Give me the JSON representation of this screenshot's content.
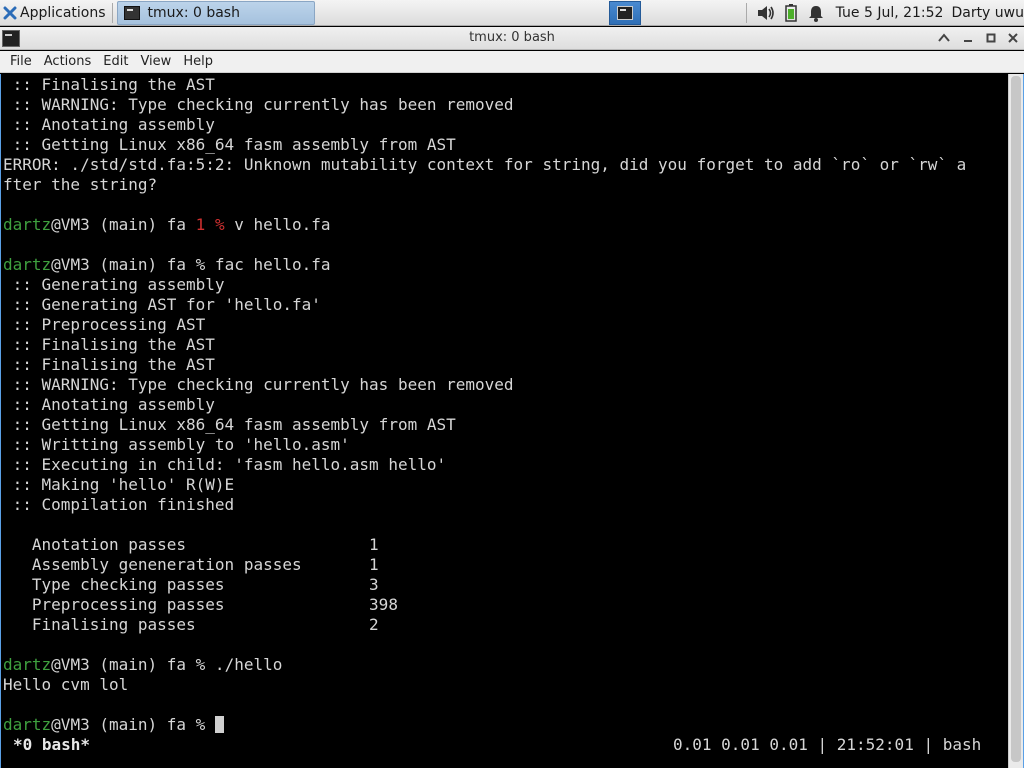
{
  "panel": {
    "apps_label": "Applications",
    "task_label": "tmux: 0 bash",
    "clock": "Tue  5 Jul, 21:52",
    "user": "Darty uwu",
    "icons": [
      "xfce-logo-icon",
      "terminal-icon",
      "volume-icon",
      "battery-icon",
      "notification-bell-icon"
    ]
  },
  "window": {
    "title": "tmux: 0 bash",
    "menu": [
      "File",
      "Actions",
      "Edit",
      "View",
      "Help"
    ]
  },
  "terminal": {
    "lines": [
      [
        {
          "t": " :: Finalising the AST"
        }
      ],
      [
        {
          "t": " :: WARNING: Type checking currently has been removed"
        }
      ],
      [
        {
          "t": " :: Anotating assembly"
        }
      ],
      [
        {
          "t": " :: Getting Linux x86_64 fasm assembly from AST"
        }
      ],
      [
        {
          "t": "ERROR: ./std/std.fa:5:2: Unknown mutability context for string, did you forget to add `ro` or `rw` a"
        }
      ],
      [
        {
          "t": "fter the string?"
        }
      ],
      [
        {
          "t": ""
        }
      ],
      [
        {
          "t": "dartz",
          "c": "user"
        },
        {
          "t": "@VM3 (main) fa "
        },
        {
          "t": "1 %",
          "c": "err"
        },
        {
          "t": " v hello.fa"
        }
      ],
      [
        {
          "t": ""
        }
      ],
      [
        {
          "t": "dartz",
          "c": "user"
        },
        {
          "t": "@VM3 (main) fa % fac hello.fa"
        }
      ],
      [
        {
          "t": " :: Generating assembly"
        }
      ],
      [
        {
          "t": " :: Generating AST for 'hello.fa'"
        }
      ],
      [
        {
          "t": " :: Preprocessing AST"
        }
      ],
      [
        {
          "t": " :: Finalising the AST"
        }
      ],
      [
        {
          "t": " :: Finalising the AST"
        }
      ],
      [
        {
          "t": " :: WARNING: Type checking currently has been removed"
        }
      ],
      [
        {
          "t": " :: Anotating assembly"
        }
      ],
      [
        {
          "t": " :: Getting Linux x86_64 fasm assembly from AST"
        }
      ],
      [
        {
          "t": " :: Writting assembly to 'hello.asm'"
        }
      ],
      [
        {
          "t": " :: Executing in child: 'fasm hello.asm hello'"
        }
      ],
      [
        {
          "t": " :: Making 'hello' R(W)E"
        }
      ],
      [
        {
          "t": " :: Compilation finished"
        }
      ],
      [
        {
          "t": ""
        }
      ],
      [
        {
          "t": "   Anotation passes                   1"
        }
      ],
      [
        {
          "t": "   Assembly geneneration passes       1"
        }
      ],
      [
        {
          "t": "   Type checking passes               3"
        }
      ],
      [
        {
          "t": "   Preprocessing passes               398"
        }
      ],
      [
        {
          "t": "   Finalising passes                  2"
        }
      ],
      [
        {
          "t": ""
        }
      ],
      [
        {
          "t": "dartz",
          "c": "user"
        },
        {
          "t": "@VM3 (main) fa % ./hello"
        }
      ],
      [
        {
          "t": "Hello cvm lol"
        }
      ],
      [
        {
          "t": ""
        }
      ],
      [
        {
          "t": "dartz",
          "c": "user"
        },
        {
          "t": "@VM3 (main) fa % "
        },
        {
          "t": "",
          "c": "cursor"
        }
      ]
    ],
    "status_left": "*0 bash*",
    "status_right": "0.01 0.01 0.01 | 21:52:01 | bash"
  },
  "colors": {
    "prompt_user": "#3fa13f",
    "error_exit": "#d03030",
    "terminal_bg": "#000000",
    "terminal_fg": "#d6d6d6",
    "workspace_active": "#2f6fb6"
  }
}
